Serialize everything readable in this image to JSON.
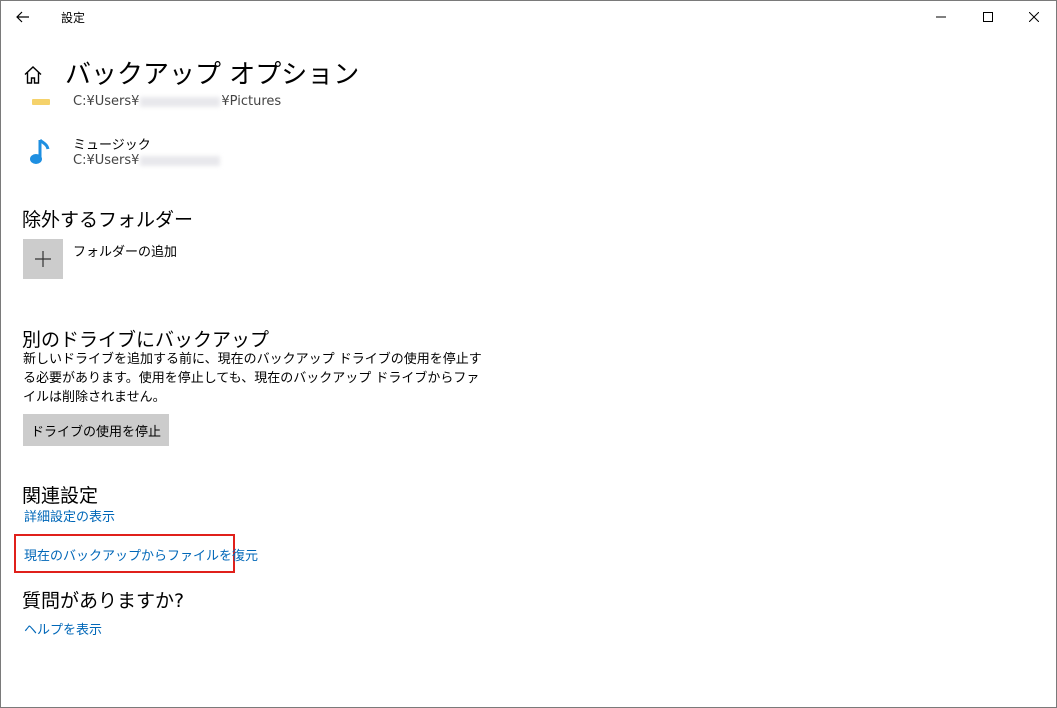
{
  "window": {
    "title": "設定",
    "controls": [
      "minimize",
      "maximize",
      "close"
    ]
  },
  "page": {
    "title": "バックアップ オプション"
  },
  "folders": [
    {
      "name": "",
      "path_prefix": "C:¥Users¥",
      "path_suffix": "¥Pictures",
      "icon": "folder-icon"
    },
    {
      "name": "ミュージック",
      "path_prefix": "C:¥Users¥",
      "path_suffix": "",
      "icon": "music-note-icon"
    }
  ],
  "exclude": {
    "heading": "除外するフォルダー",
    "add_label": "フォルダーの追加"
  },
  "other_drive": {
    "heading": "別のドライブにバックアップ",
    "description": "新しいドライブを追加する前に、現在のバックアップ ドライブの使用を停止する必要があります。使用を停止しても、現在のバックアップ ドライブからファイルは削除されません。",
    "stop_button": "ドライブの使用を停止"
  },
  "related": {
    "heading": "関連設定",
    "advanced_link": "詳細設定の表示",
    "restore_link": "現在のバックアップからファイルを復元"
  },
  "questions": {
    "heading": "質問がありますか?",
    "help_link": "ヘルプを表示"
  },
  "colors": {
    "link": "#0067b8",
    "highlight": "#e0201b",
    "button_bg": "#cccccc",
    "music_icon": "#1e8fe1",
    "folder_icon": "#f5d26b"
  }
}
